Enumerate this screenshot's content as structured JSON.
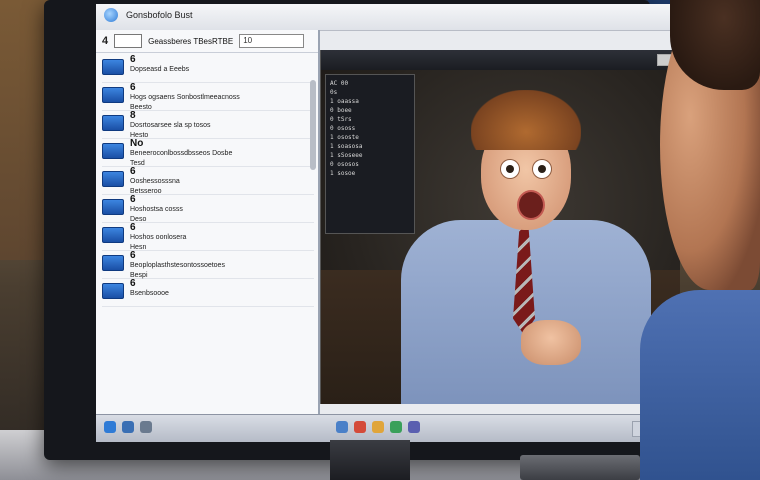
{
  "window": {
    "title": "Gonsbofolo Bust"
  },
  "left_panel": {
    "toolbar_number": "4",
    "toolbar_field_value": "",
    "toolbar_path": "Geassberes TBesRTBE",
    "toolbar_box_value": "10",
    "items": [
      {
        "number": "6",
        "line1": "Dopseasd a Eeebs",
        "line2": ""
      },
      {
        "number": "6",
        "line1": "Hogs ogsaens Sonbostlmeeacnoss",
        "line2": "Beesto"
      },
      {
        "number": "8",
        "line1": "Dosrtosarsee sla sp tosos",
        "line2": "Hesto"
      },
      {
        "number": "No",
        "line1": "Beneeroconlbossdbsseos Dosbe",
        "line2": "Tesd"
      },
      {
        "number": "6",
        "line1": "Ooshessosssna",
        "line2": "Betsseroo"
      },
      {
        "number": "6",
        "line1": "Hoshostsa cosss",
        "line2": "Deso"
      },
      {
        "number": "6",
        "line1": "Hoshos oonlosera",
        "line2": "Hesn"
      },
      {
        "number": "6",
        "line1": "Beoploplasthstesontossoetoes",
        "line2": "Bespi"
      },
      {
        "number": "6",
        "line1": "Bsenbsoooe",
        "line2": ""
      }
    ]
  },
  "right_panel": {
    "code_lines": [
      "AC 00",
      "0s",
      "1 oaassa",
      "0 boee",
      "0 tSrs",
      "0 ososs",
      "1 ososte",
      "1 soasosa",
      "1 sSoseee",
      "0 ososos",
      "1 sosoe"
    ]
  },
  "colors": {
    "accent": "#2f7bd6",
    "shirt": "#9fb2d4",
    "tie": "#7a1a1a",
    "hair": "#b06a30"
  },
  "icons": [
    "app-icon",
    "folder-icon",
    "minimize-icon"
  ]
}
